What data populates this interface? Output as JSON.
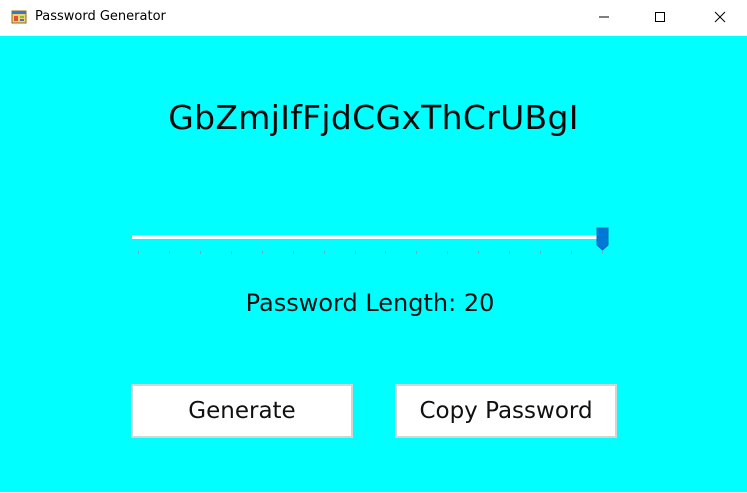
{
  "window": {
    "title": "Password Generator",
    "icon": "app-window-icon",
    "controls": {
      "minimize": "minimize-icon",
      "maximize": "maximize-icon",
      "close": "close-icon"
    }
  },
  "colors": {
    "client_background": "#00ffff",
    "slider_thumb": "#0078d7",
    "button_background": "#ffffff",
    "button_border": "#d4d4d4"
  },
  "password": {
    "value": "GbZmjIfFjdCGxThCrUBgI"
  },
  "length_slider": {
    "value": 20,
    "min": 1,
    "max": 20,
    "tick_count": 16
  },
  "length_label": {
    "text": "Password Length: 20"
  },
  "buttons": {
    "generate": "Generate",
    "copy": "Copy Password"
  }
}
